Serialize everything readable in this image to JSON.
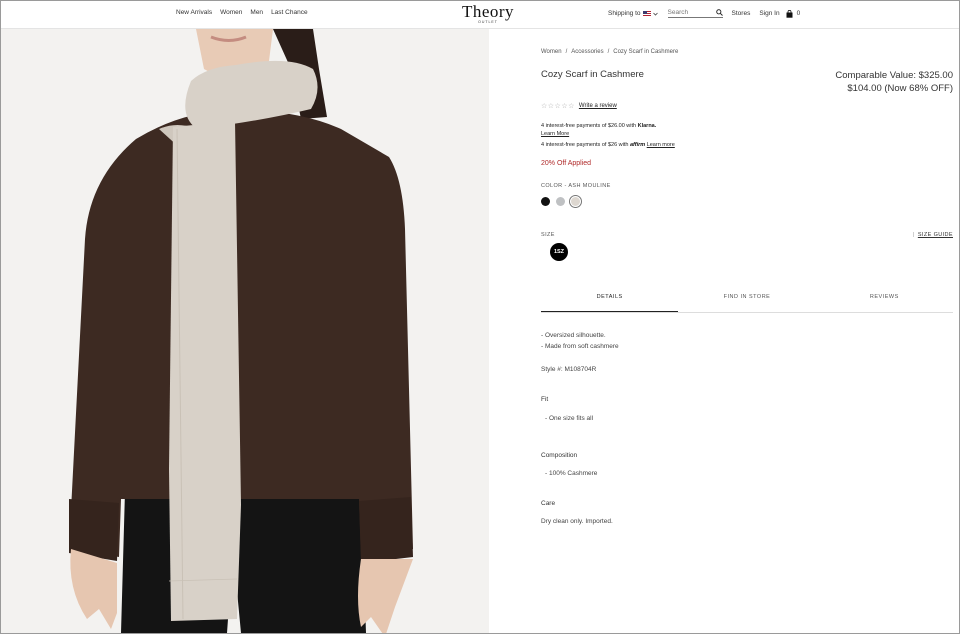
{
  "header": {
    "nav": [
      "New Arrivals",
      "Women",
      "Men",
      "Last Chance"
    ],
    "logo": {
      "brand": "Theory",
      "sub": "OUTLET"
    },
    "shipping_label": "Shipping to",
    "search_placeholder": "Search",
    "stores": "Stores",
    "signin": "Sign In",
    "bag_count": "0"
  },
  "product": {
    "breadcrumb": [
      "Women",
      "Accessories",
      "Cozy Scarf in Cashmere"
    ],
    "breadcrumb_sep": "/",
    "title": "Cozy Scarf in Cashmere",
    "comparable_value": "Comparable Value: $325.00",
    "sale_price": "$104.00 (Now 68% OFF)",
    "rating_stars": "☆☆☆☆☆",
    "write_review": "Write a review",
    "klarna_text": "4 interest-free payments of $26.00 with",
    "klarna_brand": "Klarna.",
    "klarna_learn": "Learn More",
    "affirm_text": "4 interest-free payments of $26 with",
    "affirm_brand": "affirm",
    "affirm_learn": "Learn more",
    "discount": "20% Off Applied",
    "color_label": "COLOR - ASH MOULINE",
    "swatches": [
      {
        "name": "black",
        "color": "#111111"
      },
      {
        "name": "grey",
        "color": "#bfc1c3"
      },
      {
        "name": "ash-mouline",
        "color": "#ddd7d0"
      }
    ],
    "size_label": "SIZE",
    "size_guide_sep": "|",
    "size_guide": "SIZE GUIDE",
    "size_option": "1SZ",
    "tabs": [
      "DETAILS",
      "FIND IN STORE",
      "REVIEWS"
    ],
    "details": {
      "bullets": [
        "- Oversized silhouette.",
        "- Made from soft cashmere"
      ],
      "style_no": "Style #: M108704R",
      "fit_head": "Fit",
      "fit_val": "- One size fits all",
      "comp_head": "Composition",
      "comp_val": "- 100% Cashmere",
      "care_head": "Care",
      "care_val": "Dry clean only. Imported."
    }
  },
  "colors": {
    "discount": "#b02a2a",
    "sweater": "#3d2a22",
    "scarf": "#d8d1c8",
    "background": "#f3f2f0"
  }
}
